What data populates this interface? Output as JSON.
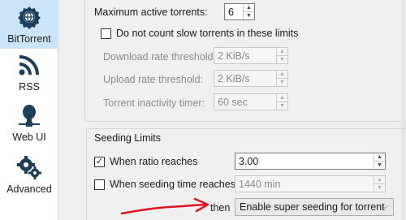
{
  "sidebar": {
    "items": [
      {
        "label": "BitTorrent",
        "icon": "gear-globe-icon",
        "selected": true
      },
      {
        "label": "RSS",
        "icon": "rss-icon"
      },
      {
        "label": "Web UI",
        "icon": "web-ui-icon"
      },
      {
        "label": "Advanced",
        "icon": "gears-icon"
      }
    ]
  },
  "queue": {
    "max_active_label": "Maximum active torrents:",
    "max_active_value": "6",
    "slow_torrents_label": "Do not count slow torrents in these limits",
    "slow_torrents_checked": false,
    "download_threshold_label": "Download rate threshold:",
    "download_threshold_value": "2 KiB/s",
    "upload_threshold_label": "Upload rate threshold:",
    "upload_threshold_value": "2 KiB/s",
    "inactivity_label": "Torrent inactivity timer:",
    "inactivity_value": "60 sec"
  },
  "seeding": {
    "group_title": "Seeding Limits",
    "ratio_label": "When ratio reaches",
    "ratio_checked": true,
    "ratio_value": "3.00",
    "time_label": "When seeding time reaches",
    "time_checked": false,
    "time_value": "1440 min",
    "then_label": "then",
    "action_value": "Enable super seeding for torrent"
  },
  "colors": {
    "selected_bg": "#cce4f7",
    "annotation": "#e0141e",
    "icon": "#1c3f5e"
  }
}
